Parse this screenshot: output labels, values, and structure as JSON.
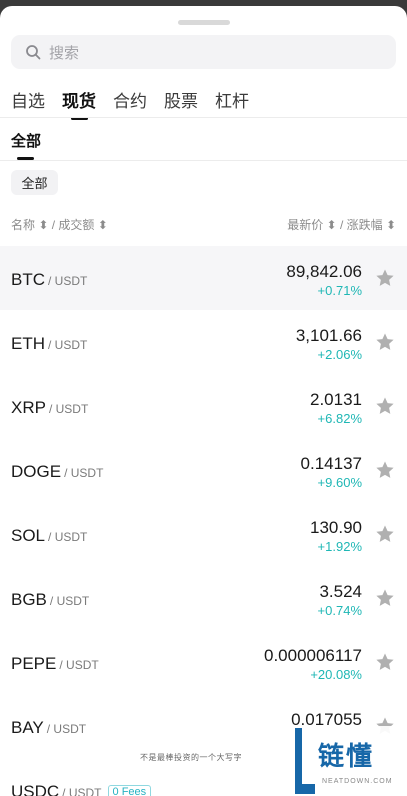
{
  "search": {
    "placeholder": "搜索"
  },
  "tabs": [
    {
      "label": "自选"
    },
    {
      "label": "现货"
    },
    {
      "label": "合约"
    },
    {
      "label": "股票"
    },
    {
      "label": "杠杆"
    }
  ],
  "subtab": {
    "label": "全部"
  },
  "filter_chip": {
    "label": "全部"
  },
  "columns": {
    "left": "名称 ⬍ / 成交额 ⬍",
    "right": "最新价 ⬍ / 涨跌幅 ⬍"
  },
  "rows": [
    {
      "base": "BTC",
      "quote": "/ USDT",
      "price": "89,842.06",
      "change": "+0.71%"
    },
    {
      "base": "ETH",
      "quote": "/ USDT",
      "price": "3,101.66",
      "change": "+2.06%"
    },
    {
      "base": "XRP",
      "quote": "/ USDT",
      "price": "2.0131",
      "change": "+6.82%"
    },
    {
      "base": "DOGE",
      "quote": "/ USDT",
      "price": "0.14137",
      "change": "+9.60%"
    },
    {
      "base": "SOL",
      "quote": "/ USDT",
      "price": "130.90",
      "change": "+1.92%"
    },
    {
      "base": "BGB",
      "quote": "/ USDT",
      "price": "3.524",
      "change": "+0.74%"
    },
    {
      "base": "PEPE",
      "quote": "/ USDT",
      "price": "0.000006117",
      "change": "+20.08%"
    },
    {
      "base": "BAY",
      "quote": "/ USDT",
      "price": "0.017055",
      "change": ""
    },
    {
      "base": "USDC",
      "quote": "/ USDT",
      "badge": "0 Fees",
      "price": "",
      "change": ""
    }
  ],
  "watermark": {
    "caption": "不是最棒投资的一个大写字",
    "logo": "链懂",
    "logo_sub": "NEATDOWN.COM"
  },
  "colors": {
    "positive": "#1fb7b5",
    "star": "#b0b0b0",
    "logo": "#1767a8"
  }
}
